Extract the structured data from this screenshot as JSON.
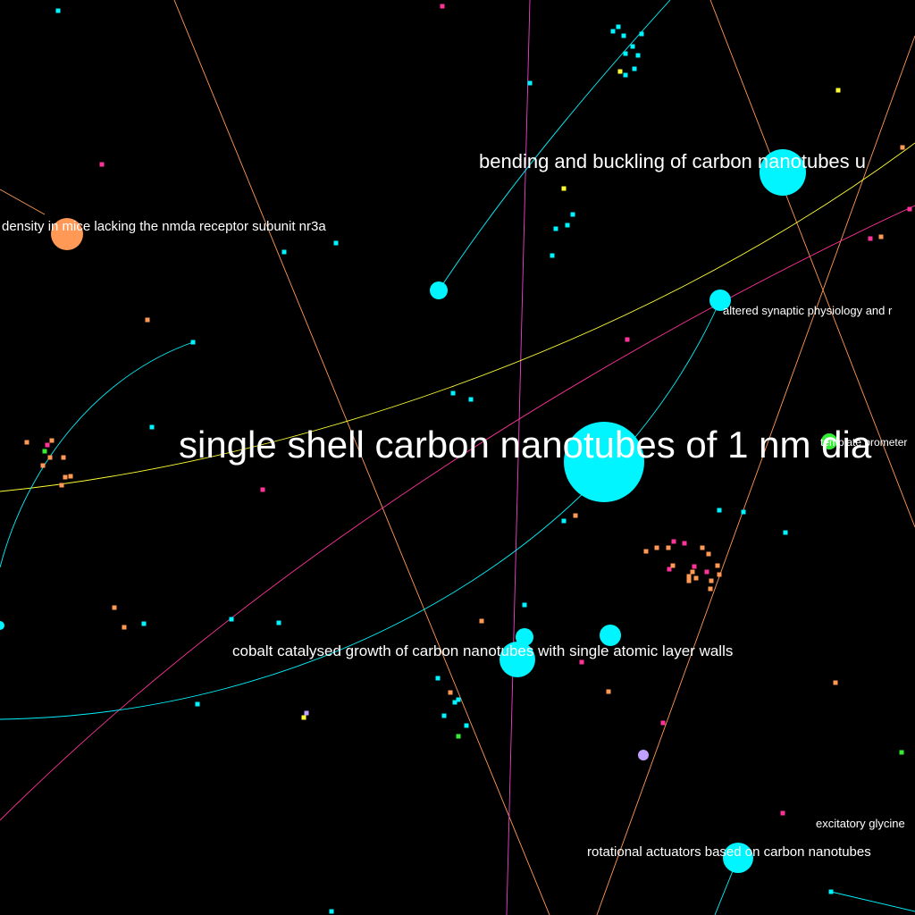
{
  "colors": {
    "background": "#000000",
    "cyan": "#00f5ff",
    "orange": "#ff9955",
    "pink": "#ff3399",
    "magenta": "#ee44cc",
    "yellow": "#ffff33",
    "green": "#33ee33",
    "lavender": "#c0a0ff",
    "label": "#ffffff"
  },
  "labels": {
    "main": "single shell carbon nanotubes of 1 nm dia",
    "bending": "bending and buckling of carbon nanotubes u",
    "nmda": "density in mice lacking the nmda receptor subunit nr3a",
    "synaptic": "altered synaptic physiology and r",
    "template": "template prometer",
    "cobalt": "cobalt catalysed growth of carbon nanotubes with single atomic layer walls",
    "excitatory": "excitatory glycine",
    "rotational": "rotational actuators based on carbon nanotubes"
  }
}
